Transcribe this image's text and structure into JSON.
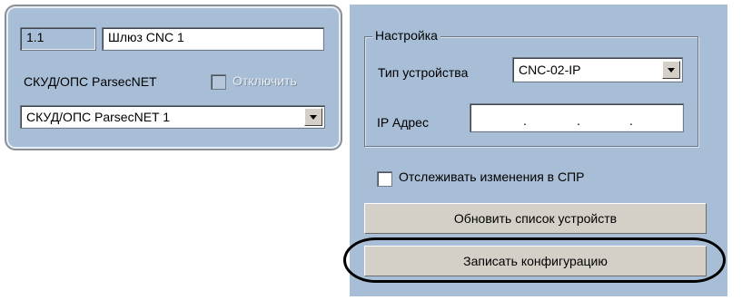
{
  "left_panel": {
    "id_value": "1.1",
    "name_value": "Шлюз CNC 1",
    "skud_label": "СКУД/ОПС ParsecNET",
    "disable_label": "Отключить",
    "disable_checked": false,
    "skud_select_value": "СКУД/ОПС ParsecNET 1"
  },
  "settings": {
    "legend": "Настройка",
    "device_type_label": "Тип устройства",
    "device_type_value": "CNC-02-IP",
    "ip_label": "IP Адрес",
    "ip_dots": [
      ".",
      ".",
      "."
    ]
  },
  "track_changes": {
    "label": "Отслеживать изменения в СПР",
    "checked": false
  },
  "buttons": {
    "refresh_label": "Обновить список устройств",
    "write_label": "Записать конфигурацию"
  },
  "colors": {
    "panel": "#a8bdd6",
    "button_face": "#d4d0c8"
  }
}
